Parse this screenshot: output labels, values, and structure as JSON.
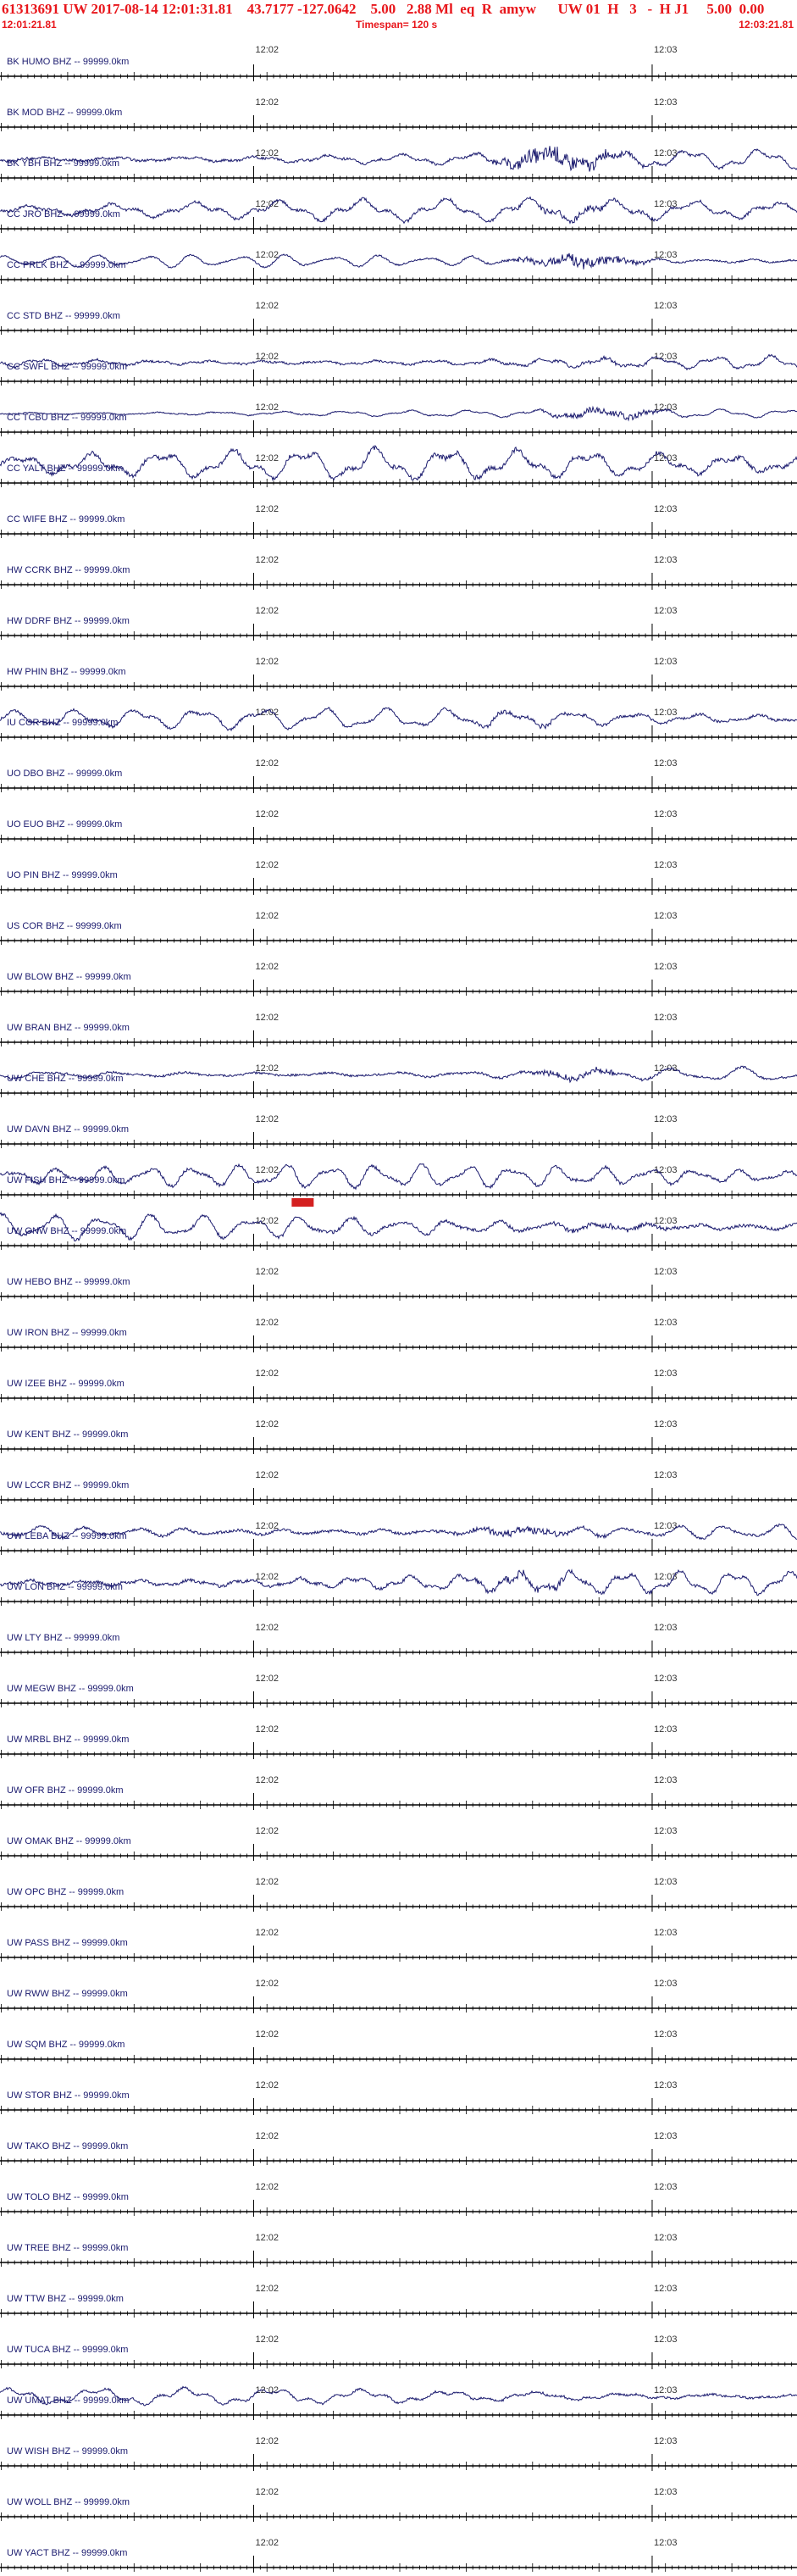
{
  "header": {
    "title": "61313691 UW 2017-08-14 12:01:31.81    43.7177 -127.0642    5.00   2.88 Ml  eq  R  amyw      UW 01  H   3   -  H J1     5.00  0.00",
    "start_time": "12:01:21.81",
    "end_time": "12:03:21.81",
    "timespan": "Timespan= 120 s"
  },
  "colors": {
    "header_text": "#e8161b",
    "trace": "#1a1a6e",
    "axis": "#000000",
    "pick_marker": "#d42020"
  },
  "chart_data": {
    "type": "line",
    "title": "61313691 UW 2017-08-14 12:01:31.81",
    "x_range_seconds": [
      0,
      120
    ],
    "time_ticks": [
      {
        "label": "12:02",
        "seconds": 38.19
      },
      {
        "label": "12:03",
        "seconds": 98.19
      }
    ],
    "pick": {
      "station": "UW GNW BHZ",
      "seconds": 45.7
    },
    "series": [
      {
        "name": "BK HUMO BHZ -- 99999.0km",
        "amplitude": 0,
        "burst": 0
      },
      {
        "name": "BK MOD BHZ -- 99999.0km",
        "amplitude": 0,
        "burst": 0
      },
      {
        "name": "BK YBH BHZ -- 99999.0km",
        "amplitude": 0.45,
        "burst": 1
      },
      {
        "name": "CC JRO BHZ -- 99999.0km",
        "amplitude": 0.55,
        "burst": 0.3
      },
      {
        "name": "CC PRLK BHZ -- 99999.0km",
        "amplitude": 0.3,
        "burst": 1
      },
      {
        "name": "CC STD BHZ -- 99999.0km",
        "amplitude": 0,
        "burst": 0
      },
      {
        "name": "CC SWFL BHZ -- 99999.0km",
        "amplitude": 0.4,
        "burst": 0.2
      },
      {
        "name": "CC TCBU BHZ -- 99999.0km",
        "amplitude": 0.2,
        "burst": 1
      },
      {
        "name": "CC YALT BHZ -- 99999.0km",
        "amplitude": 0.75,
        "burst": 0.1
      },
      {
        "name": "CC WIFE BHZ -- 99999.0km",
        "amplitude": 0,
        "burst": 0
      },
      {
        "name": "HW CCRK BHZ -- 99999.0km",
        "amplitude": 0,
        "burst": 0
      },
      {
        "name": "HW DDRF BHZ -- 99999.0km",
        "amplitude": 0,
        "burst": 0
      },
      {
        "name": "HW PHIN BHZ -- 99999.0km",
        "amplitude": 0,
        "burst": 0
      },
      {
        "name": "IU COR BHZ -- 99999.0km",
        "amplitude": 0.5,
        "burst": 0.2
      },
      {
        "name": "UO DBO BHZ -- 99999.0km",
        "amplitude": 0,
        "burst": 0
      },
      {
        "name": "UO EUO BHZ -- 99999.0km",
        "amplitude": 0,
        "burst": 0
      },
      {
        "name": "UO PIN BHZ -- 99999.0km",
        "amplitude": 0,
        "burst": 0
      },
      {
        "name": "US COR BHZ -- 99999.0km",
        "amplitude": 0,
        "burst": 0
      },
      {
        "name": "UW BLOW BHZ -- 99999.0km",
        "amplitude": 0,
        "burst": 0
      },
      {
        "name": "UW BRAN BHZ -- 99999.0km",
        "amplitude": 0,
        "burst": 0
      },
      {
        "name": "UW CHE BHZ -- 99999.0km",
        "amplitude": 0.4,
        "burst": 0.4
      },
      {
        "name": "UW DAVN BHZ -- 99999.0km",
        "amplitude": 0,
        "burst": 0
      },
      {
        "name": "UW FISH BHZ -- 99999.0km",
        "amplitude": 0.55,
        "burst": 0
      },
      {
        "name": "UW GNW BHZ -- 99999.0km",
        "amplitude": 0.6,
        "burst": 0.2
      },
      {
        "name": "UW HEBO BHZ -- 99999.0km",
        "amplitude": 0,
        "burst": 0
      },
      {
        "name": "UW IRON BHZ -- 99999.0km",
        "amplitude": 0,
        "burst": 0
      },
      {
        "name": "UW IZEE BHZ -- 99999.0km",
        "amplitude": 0,
        "burst": 0
      },
      {
        "name": "UW KENT BHZ -- 99999.0km",
        "amplitude": 0,
        "burst": 0
      },
      {
        "name": "UW LCCR BHZ -- 99999.0km",
        "amplitude": 0,
        "burst": 0
      },
      {
        "name": "UW LEBA BHZ -- 99999.0km",
        "amplitude": 0.5,
        "burst": 0.4
      },
      {
        "name": "UW LON BHZ -- 99999.0km",
        "amplitude": 0.55,
        "burst": 0.4
      },
      {
        "name": "UW LTY BHZ -- 99999.0km",
        "amplitude": 0,
        "burst": 0
      },
      {
        "name": "UW MEGW BHZ -- 99999.0km",
        "amplitude": 0,
        "burst": 0
      },
      {
        "name": "UW MRBL BHZ -- 99999.0km",
        "amplitude": 0,
        "burst": 0
      },
      {
        "name": "UW OFR BHZ -- 99999.0km",
        "amplitude": 0,
        "burst": 0
      },
      {
        "name": "UW OMAK BHZ -- 99999.0km",
        "amplitude": 0,
        "burst": 0
      },
      {
        "name": "UW OPC BHZ -- 99999.0km",
        "amplitude": 0,
        "burst": 0
      },
      {
        "name": "UW PASS BHZ -- 99999.0km",
        "amplitude": 0,
        "burst": 0
      },
      {
        "name": "UW RWW BHZ -- 99999.0km",
        "amplitude": 0,
        "burst": 0
      },
      {
        "name": "UW SQM BHZ -- 99999.0km",
        "amplitude": 0,
        "burst": 0
      },
      {
        "name": "UW STOR BHZ -- 99999.0km",
        "amplitude": 0,
        "burst": 0
      },
      {
        "name": "UW TAKO BHZ -- 99999.0km",
        "amplitude": 0,
        "burst": 0
      },
      {
        "name": "UW TOLO BHZ -- 99999.0km",
        "amplitude": 0,
        "burst": 0
      },
      {
        "name": "UW TREE BHZ -- 99999.0km",
        "amplitude": 0,
        "burst": 0
      },
      {
        "name": "UW TTW BHZ -- 99999.0km",
        "amplitude": 0,
        "burst": 0
      },
      {
        "name": "UW TUCA BHZ -- 99999.0km",
        "amplitude": 0,
        "burst": 0
      },
      {
        "name": "UW UMAT BHZ -- 99999.0km",
        "amplitude": 0.4,
        "burst": 0.1
      },
      {
        "name": "UW WISH BHZ -- 99999.0km",
        "amplitude": 0,
        "burst": 0
      },
      {
        "name": "UW WOLL BHZ -- 99999.0km",
        "amplitude": 0,
        "burst": 0
      },
      {
        "name": "UW YACT BHZ -- 99999.0km",
        "amplitude": 0,
        "burst": 0
      }
    ]
  }
}
